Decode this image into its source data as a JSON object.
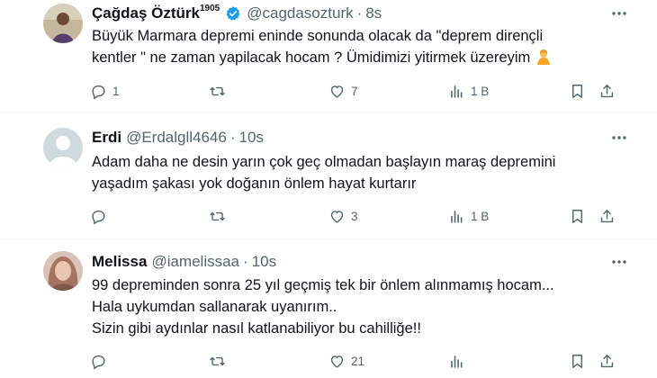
{
  "tweets": [
    {
      "name": "Çağdaş Öztürk",
      "name_sup": "1905",
      "verified": true,
      "handle": "@cagdasozturk",
      "time": "8s",
      "lines": [
        "Büyük Marmara depremi eninde sonunda olacak da \"deprem dirençli",
        "kentler \" ne zaman yapilacak hocam ? Ümidimizi yitirmek üzereyim"
      ],
      "replies": "1",
      "retweets": "",
      "likes": "7",
      "views": "1 B",
      "avatar_color": "#b9a88c"
    },
    {
      "name": "Erdi",
      "handle": "@Erdalgll4646",
      "time": "10s",
      "lines": [
        "Adam daha ne desin yarın çok geç olmadan başlayın maraş depremini",
        "yaşadım şakası yok doğanın önlem hayat kurtarır"
      ],
      "replies": "",
      "retweets": "",
      "likes": "3",
      "views": "1 B",
      "avatar_color": "#cfd9de"
    },
    {
      "name": "Melissa",
      "handle": "@iamelissaa",
      "time": "10s",
      "lines": [
        "99 depreminden sonra 25 yıl geçmiş tek bir önlem alınmamış hocam...",
        "Hala uykumdan sallanarak uyanırım..",
        "Sizin gibi aydınlar nasıl katlanabiliyor bu cahilliğe!!"
      ],
      "replies": "",
      "retweets": "",
      "likes": "21",
      "views": "",
      "avatar_color": "#c9a999"
    }
  ],
  "colors": {
    "text": "#0f1419",
    "muted": "#536471",
    "verified": "#1d9bf0",
    "divider": "#eff3f4"
  },
  "icons": [
    "verified-badge-icon",
    "more-icon",
    "reply-icon",
    "retweet-icon",
    "like-icon",
    "views-icon",
    "bookmark-icon",
    "share-icon",
    "person-gesturing-emoji"
  ]
}
